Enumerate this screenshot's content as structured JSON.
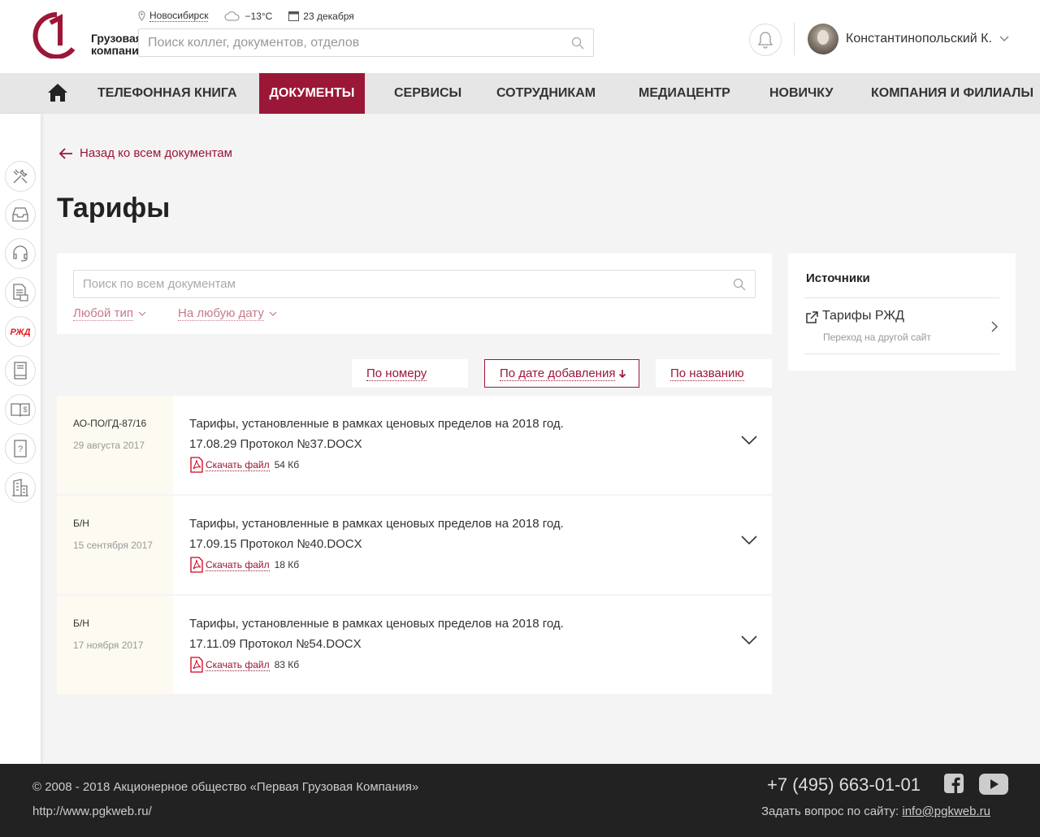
{
  "header": {
    "logo_line1": "Грузовая",
    "logo_line2": "компания",
    "city": "Новосибирск",
    "weather": "−13°C",
    "date": "23 декабря",
    "search_placeholder": "Поиск коллег, документов, отделов",
    "user_name": "Константинопольский К."
  },
  "nav": {
    "items": [
      {
        "label": "Телефонная книга"
      },
      {
        "label": "Документы"
      },
      {
        "label": "Сервисы"
      },
      {
        "label": "Сотрудникам"
      },
      {
        "label": "Медиацентр"
      },
      {
        "label": "Новичку"
      },
      {
        "label": "Компания и филиалы"
      }
    ],
    "active_color": "#9b1737"
  },
  "sidebar": {
    "icons": [
      "tools-icon",
      "inbox-icon",
      "headset-icon",
      "document-mail-icon",
      "rzd-logo-icon",
      "book-icon",
      "money-book-icon",
      "help-icon",
      "buildings-icon"
    ],
    "rzd_label": "РЖД"
  },
  "page": {
    "back_label": "Назад ко всем документам",
    "title": "Тарифы"
  },
  "filters": {
    "search_placeholder": "Поиск по всем документам",
    "type_label": "Любой тип",
    "date_label": "На любую дату"
  },
  "sort": {
    "by_number": "По номеру",
    "by_date": "По дате добавления",
    "by_name": "По названию"
  },
  "documents": [
    {
      "number": "АО-ПО/ГД-87/16",
      "date": "29 августа 2017",
      "title_line1": "Тарифы, установленные в рамках ценовых пределов на 2018 год.",
      "title_line2": "17.08.29 Протокол №37.DOCX",
      "download_label": "Скачать файл",
      "size": "54 Кб"
    },
    {
      "number": "Б/Н",
      "date": "15 сентября 2017",
      "title_line1": "Тарифы, установленные в рамках ценовых пределов на 2018 год.",
      "title_line2": "17.09.15 Протокол №40.DOCX",
      "download_label": "Скачать файл",
      "size": "18 Кб"
    },
    {
      "number": "Б/Н",
      "date": "17 ноября 2017",
      "title_line1": "Тарифы, установленные в рамках ценовых пределов на 2018 год.",
      "title_line2": "17.11.09 Протокол №54.DOCX",
      "download_label": "Скачать файл",
      "size": "83 Кб"
    }
  ],
  "sources": {
    "title": "Источники",
    "link_name": "Тарифы РЖД",
    "link_note": "Переход на другой сайт"
  },
  "footer": {
    "copyright": "© 2008 - 2018 Акционерное общество «Первая Грузовая Компания»",
    "site": "http://www.pgkweb.ru/",
    "phone": "+7 (495) 663-01-01",
    "ask_label": "Задать вопрос по сайту:",
    "email": "info@pgkweb.ru"
  }
}
